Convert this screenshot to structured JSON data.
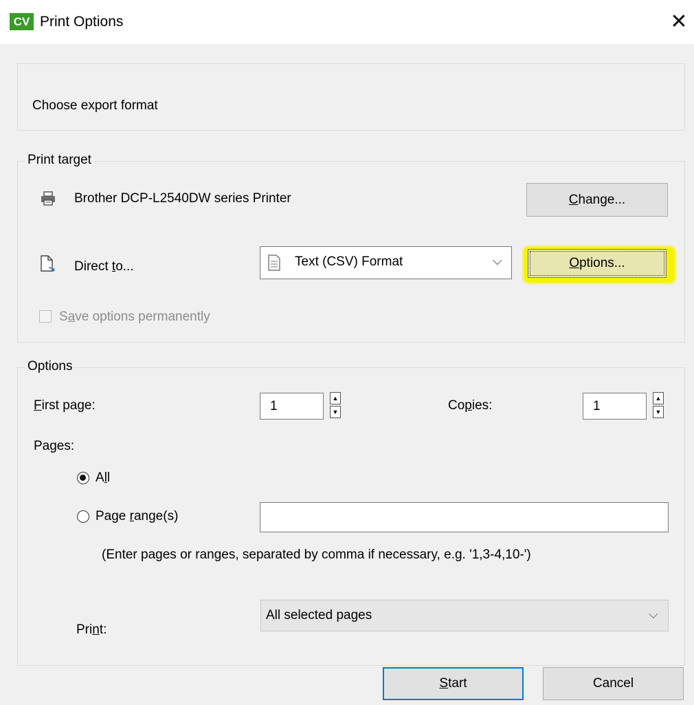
{
  "window": {
    "app_logo": "CV",
    "title": "Print Options",
    "close_glyph": "✕"
  },
  "export": {
    "heading": "Choose export format"
  },
  "print_target": {
    "group_label": "Print target",
    "printer_name": "Brother DCP-L2540DW series Printer",
    "change_button": {
      "pre": "",
      "mnemonic": "C",
      "post": "hange..."
    },
    "direct_to": {
      "pre": "Direct ",
      "mnemonic": "t",
      "post": "o..."
    },
    "format_combo": {
      "value": "Text (CSV) Format",
      "arrow": "⌵"
    },
    "options_button": {
      "pre": "",
      "mnemonic": "O",
      "post": "ptions..."
    },
    "save_checkbox": {
      "pre": "S",
      "mnemonic": "a",
      "post": "ve options permanently",
      "checked": false,
      "enabled": false
    }
  },
  "options": {
    "group_label": "Options",
    "first_page": {
      "pre": "",
      "mnemonic": "F",
      "post": "irst page:",
      "value": "1"
    },
    "copies": {
      "pre": "Co",
      "mnemonic": "p",
      "post": "ies:",
      "value": "1"
    },
    "pages_label": "Pages:",
    "radio_all": {
      "pre": "A",
      "mnemonic": "l",
      "post": "l",
      "checked": true
    },
    "radio_range": {
      "pre": "Page ",
      "mnemonic": "r",
      "post": "ange(s)",
      "checked": false
    },
    "range_input_value": "",
    "range_hint": "(Enter pages or ranges, separated by comma if necessary, e.g. '1,3-4,10-')",
    "print": {
      "pre": "Pri",
      "mnemonic": "n",
      "post": "t:",
      "selected": "All selected pages",
      "arrow": "⌵"
    }
  },
  "footer": {
    "start_button": {
      "pre": "",
      "mnemonic": "S",
      "post": "tart"
    },
    "cancel_button": "Cancel"
  },
  "colors": {
    "highlight": "#f6f200",
    "logo": "#3a9a2a",
    "dialog_bg": "#f0f0f0"
  },
  "icons": {
    "printer": "printer-icon",
    "export_file": "export-file-icon",
    "document": "document-icon"
  }
}
